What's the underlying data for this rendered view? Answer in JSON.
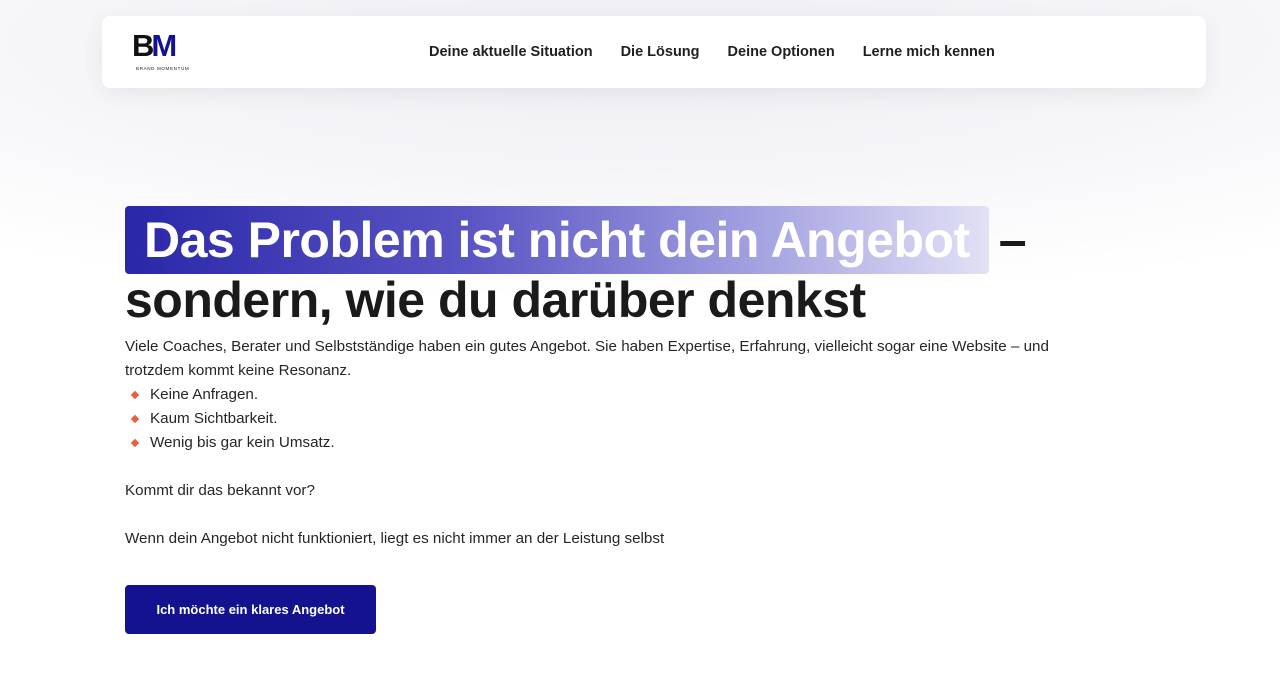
{
  "brand": {
    "logo_mark_b": "B",
    "logo_mark_m": "M",
    "logo_subtitle": "BRAND MOMENTUM",
    "accent_color": "#14128f"
  },
  "nav": {
    "items": [
      {
        "label": "Deine aktuelle Situation"
      },
      {
        "label": "Die Lösung"
      },
      {
        "label": "Deine Optionen"
      },
      {
        "label": "Lerne mich kennen"
      }
    ]
  },
  "hero": {
    "highlight": "Das Problem ist nicht dein Angebot",
    "dash": "–",
    "line2": "sondern, wie du darüber denkst",
    "intro": "Viele Coaches, Berater und Selbstständige haben ein gutes Angebot. Sie haben Expertise, Erfahrung, vielleicht sogar eine Website – und trotzdem kommt keine Resonanz.",
    "bullets": [
      "Keine Anfragen.",
      "Kaum Sichtbarkeit.",
      "Wenig bis gar kein Umsatz."
    ],
    "bullet_color": "#e8613c",
    "question": "Kommt dir das bekannt vor?",
    "statement": "Wenn dein Angebot nicht funktioniert, liegt es nicht immer an der Leistung selbst",
    "cta_label": "Ich möchte ein klares Angebot"
  }
}
